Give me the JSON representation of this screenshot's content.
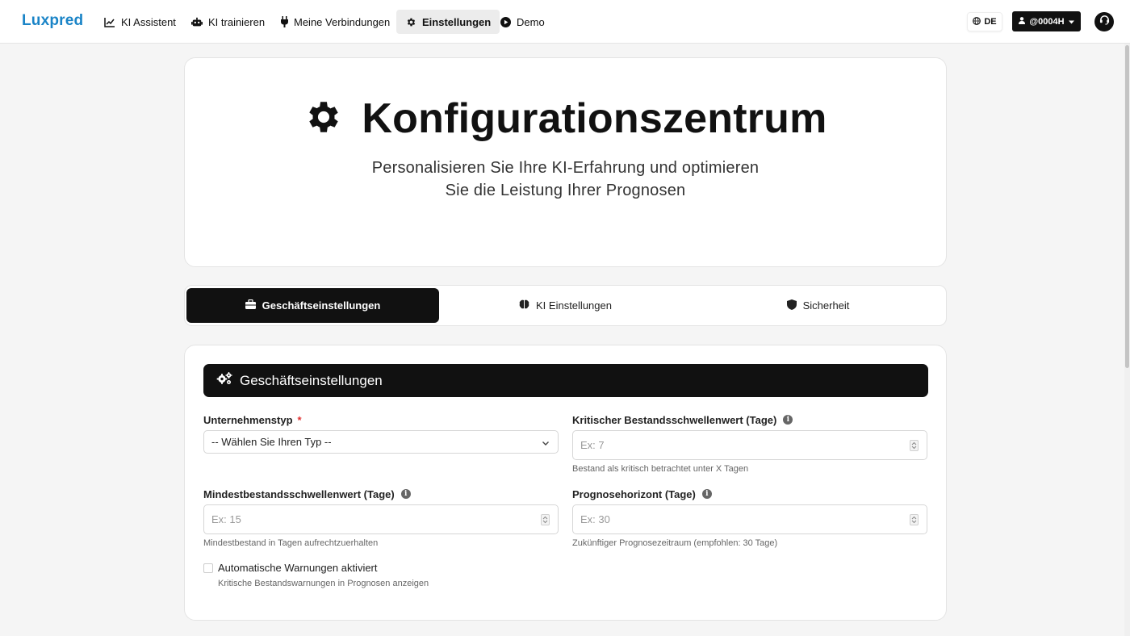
{
  "brand": {
    "logo": "Luxpred"
  },
  "nav": {
    "items": [
      {
        "label": "KI Assistent",
        "icon": "chart-line-icon"
      },
      {
        "label": "KI trainieren",
        "icon": "robot-icon"
      },
      {
        "label": "Meine Verbindungen",
        "icon": "plug-icon"
      },
      {
        "label": "Einstellungen",
        "icon": "gear-icon",
        "active": true
      },
      {
        "label": "Demo",
        "icon": "play-circle-icon"
      }
    ],
    "language": "DE",
    "user": "@0004H"
  },
  "hero": {
    "title": "Konfigurationszentrum",
    "subtitle_line1": "Personalisieren Sie Ihre KI-Erfahrung und optimieren",
    "subtitle_line2": "Sie die Leistung Ihrer Prognosen"
  },
  "tabs": [
    {
      "label": "Geschäftseinstellungen",
      "icon": "briefcase-icon",
      "active": true
    },
    {
      "label": "KI Einstellungen",
      "icon": "brain-icon",
      "active": false
    },
    {
      "label": "Sicherheit",
      "icon": "shield-icon",
      "active": false
    }
  ],
  "section": {
    "title": "Geschäftseinstellungen",
    "company_type": {
      "label": "Unternehmenstyp",
      "required_mark": "*",
      "selected": "-- Wählen Sie Ihren Typ --"
    },
    "critical_threshold": {
      "label": "Kritischer Bestandsschwellenwert (Tage)",
      "placeholder": "Ex: 7",
      "hint": "Bestand als kritisch betrachtet unter X Tagen"
    },
    "min_threshold": {
      "label": "Mindestbestandsschwellenwert (Tage)",
      "placeholder": "Ex: 15",
      "hint": "Mindestbestand in Tagen aufrechtzuerhalten"
    },
    "forecast_horizon": {
      "label": "Prognosehorizont (Tage)",
      "placeholder": "Ex: 30",
      "hint": "Zukünftiger Prognosezeitraum (empfohlen: 30 Tage)"
    },
    "auto_warnings": {
      "label": "Automatische Warnungen aktiviert",
      "hint": "Kritische Bestandswarnungen in Prognosen anzeigen",
      "checked": false
    }
  },
  "colors": {
    "brand_blue": "#1a84c7",
    "brand_accent": "#ff6a3d",
    "dark": "#111111",
    "required": "#e03131"
  }
}
